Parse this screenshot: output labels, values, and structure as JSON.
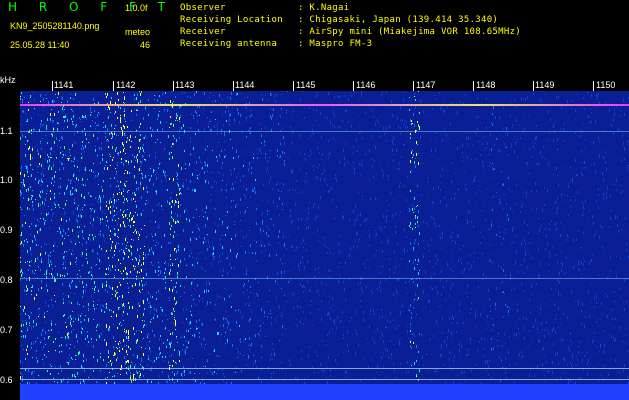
{
  "header": {
    "app_title": "H R O F F T",
    "version": "1.0.0f",
    "filename": "KN9_2505281140.png",
    "timestamp": "25.05.28 11:40",
    "meteor_label": "meteo",
    "meteor_count": "46",
    "info": [
      {
        "label": "Observer",
        "value": ": K.Nagai"
      },
      {
        "label": "Receiving Location",
        "value": ": Chigasaki, Japan (139.414 35.340)"
      },
      {
        "label": "Receiver",
        "value": ": AirSpy mini (Miakejima VOR 108.65MHz)"
      },
      {
        "label": "Receiving antenna",
        "value": ": Maspro FM-3"
      }
    ]
  },
  "spectrogram": {
    "unit_label": "kHz",
    "x_ticks": [
      "1141",
      "1142",
      "1143",
      "1144",
      "1145",
      "1146",
      "1147",
      "1148",
      "1149",
      "1150"
    ],
    "y_ticks": [
      "1.1",
      "1.0",
      "0.9",
      "0.8",
      "0.7",
      "0.6"
    ],
    "colors": {
      "background": "#0a1e96",
      "noise_high": "#10c8ff",
      "burst": "#ffff00",
      "carrier": "#ff60ff"
    }
  }
}
